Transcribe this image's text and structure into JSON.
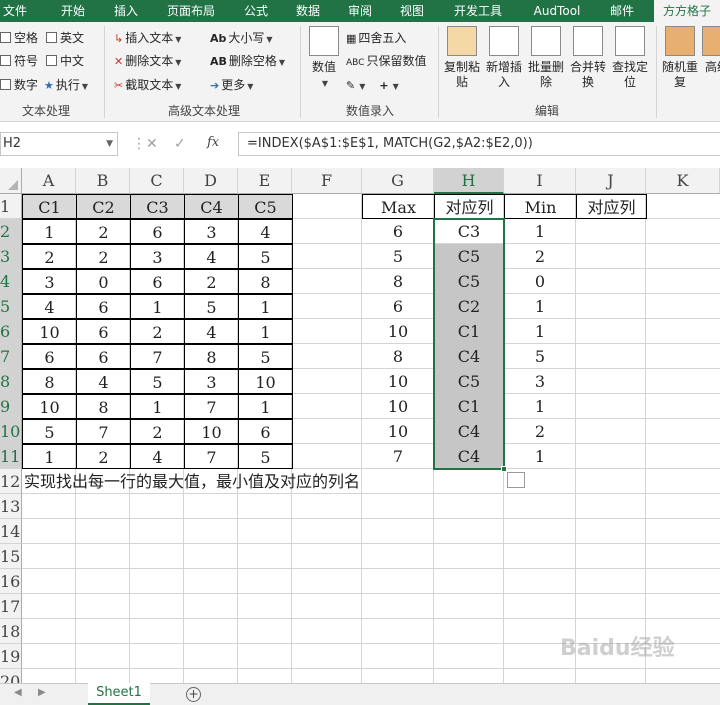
{
  "ribbon_tabs": [
    "文件",
    "开始",
    "插入",
    "页面布局",
    "公式",
    "数据",
    "审阅",
    "视图",
    "开发工具",
    "AudTool",
    "邮件",
    "方方格子"
  ],
  "ribbon": {
    "text_group": {
      "items": [
        "空格",
        "英文",
        "符号",
        "中文",
        "数字",
        "执行"
      ],
      "label": "文本处理"
    },
    "advanced_text": {
      "items": [
        "插入文本",
        "大小写",
        "删除文本",
        "删除空格",
        "截取文本",
        "更多"
      ],
      "label": "高级文本处理"
    },
    "value_entry": {
      "big": "数值",
      "items": [
        "四舍五入",
        "只保留数值"
      ],
      "label": "数值录入"
    },
    "edit": {
      "buttons": [
        "复制粘贴",
        "新增插入",
        "批量删除",
        "合并转换",
        "查找定位"
      ],
      "label": "编辑"
    },
    "extra": [
      "随机重复",
      "高级"
    ]
  },
  "name_box": "H2",
  "formula": "=INDEX($A$1:$E$1, MATCH(G2,$A2:$E2,0))",
  "columns": [
    "A",
    "B",
    "C",
    "D",
    "E",
    "F",
    "G",
    "H",
    "I",
    "J",
    "K"
  ],
  "rows": [
    "1",
    "2",
    "3",
    "4",
    "5",
    "6",
    "7",
    "8",
    "9",
    "10",
    "11",
    "12",
    "13",
    "14",
    "15",
    "16",
    "17",
    "18",
    "19",
    "20"
  ],
  "table_headers": [
    "C1",
    "C2",
    "C3",
    "C4",
    "C5"
  ],
  "table_rows": [
    [
      "1",
      "2",
      "6",
      "3",
      "4"
    ],
    [
      "2",
      "2",
      "3",
      "4",
      "5"
    ],
    [
      "3",
      "0",
      "6",
      "2",
      "8"
    ],
    [
      "4",
      "6",
      "1",
      "5",
      "1"
    ],
    [
      "10",
      "6",
      "2",
      "4",
      "1"
    ],
    [
      "6",
      "6",
      "7",
      "8",
      "5"
    ],
    [
      "8",
      "4",
      "5",
      "3",
      "10"
    ],
    [
      "10",
      "8",
      "1",
      "7",
      "1"
    ],
    [
      "5",
      "7",
      "2",
      "10",
      "6"
    ],
    [
      "1",
      "2",
      "4",
      "7",
      "5"
    ]
  ],
  "result_headers": [
    "Max",
    "对应列",
    "Min",
    "对应列"
  ],
  "result_rows": [
    [
      "6",
      "C3",
      "1"
    ],
    [
      "5",
      "C5",
      "2"
    ],
    [
      "8",
      "C5",
      "0"
    ],
    [
      "6",
      "C2",
      "1"
    ],
    [
      "10",
      "C1",
      "1"
    ],
    [
      "8",
      "C4",
      "5"
    ],
    [
      "10",
      "C5",
      "3"
    ],
    [
      "10",
      "C1",
      "1"
    ],
    [
      "10",
      "C4",
      "2"
    ],
    [
      "7",
      "C4",
      "1"
    ]
  ],
  "note": "实现找出每一行的最大值，最小值及对应的列名",
  "sheet_tab": "Sheet1",
  "watermark": "Baidu经验",
  "colors": {
    "excel_green": "#217346",
    "selection_gray": "#c6c6c6"
  }
}
